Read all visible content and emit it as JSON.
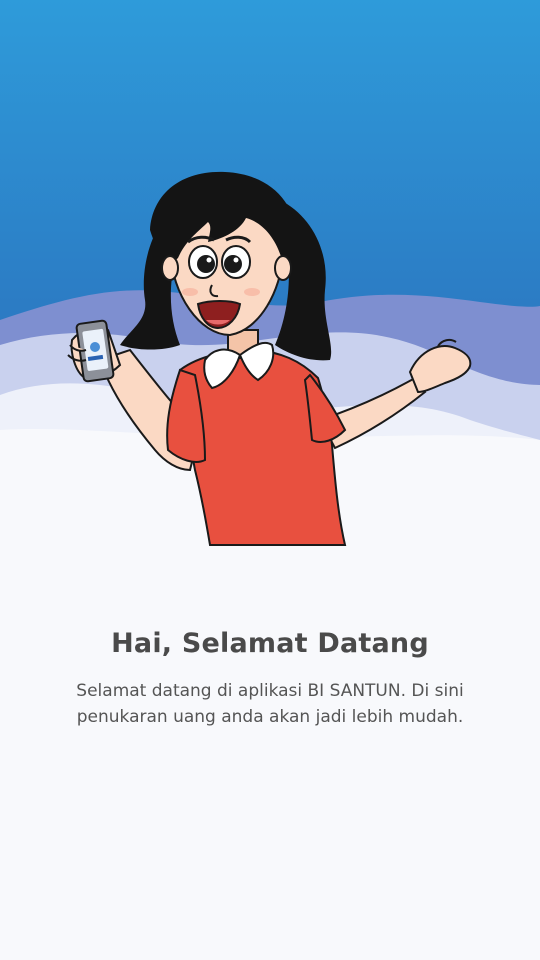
{
  "onboarding": {
    "title": "Hai, Selamat Datang",
    "description": "Selamat datang di aplikasi BI SANTUN. Di sini penukaran uang anda akan jadi lebih mudah."
  },
  "hero": {
    "illustration": "woman-holding-phone-waving",
    "sky_top_color": "#2D97D6",
    "sky_bottom_color": "#2A67B5",
    "dress_color": "#E8503F",
    "background_color": "#F8F9FC"
  }
}
